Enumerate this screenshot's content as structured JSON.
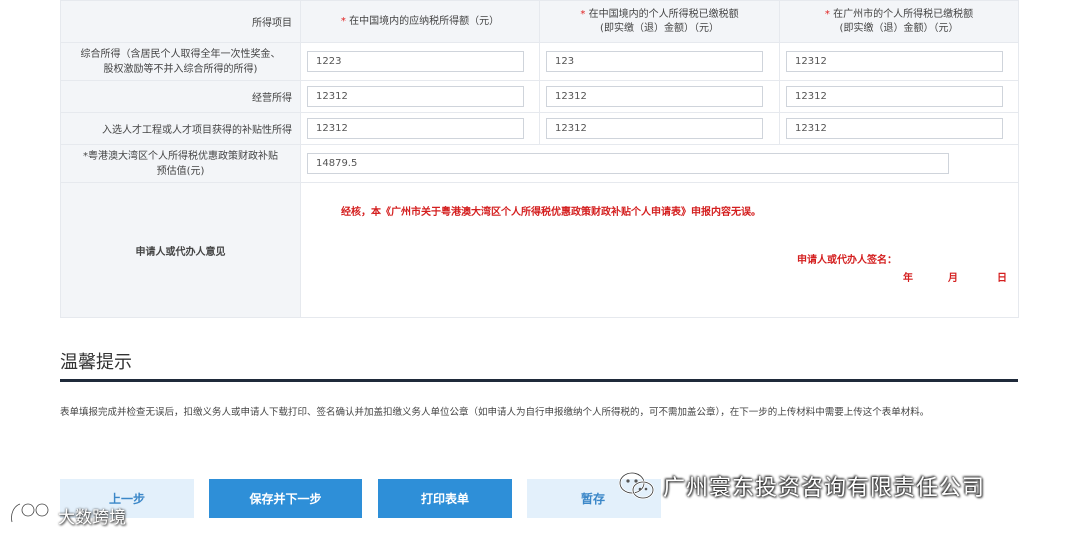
{
  "table": {
    "header": {
      "item_label": "所得项目",
      "col1_req": "*",
      "col1": "在中国境内的应纳税所得额（元）",
      "col2_req": "*",
      "col2_line1": "在中国境内的个人所得税已缴税额",
      "col2_line2": "(即实缴（退）金额）（元）",
      "col3_req": "*",
      "col3_line1": "在广州市的个人所得税已缴税额",
      "col3_line2": "(即实缴（退）金额）（元）"
    },
    "rows": [
      {
        "label_line1": "综合所得（含居民个人取得全年一次性奖金、",
        "label_line2": "股权激励等不并入综合所得的所得)",
        "values": [
          "1223",
          "123",
          "12312"
        ]
      },
      {
        "label": "经营所得",
        "values": [
          "12312",
          "12312",
          "12312"
        ]
      },
      {
        "label": "入选人才工程或人才项目获得的补贴性所得",
        "values": [
          "12312",
          "12312",
          "12312"
        ]
      }
    ],
    "estimate": {
      "label_line1": "*粤港澳大湾区个人所得税优惠政策财政补贴",
      "label_line2": "预估值(元)",
      "value": "14879.5"
    },
    "opinion": {
      "label": "申请人或代办人意见",
      "statement": "经核，本《广州市关于粤港澳大湾区个人所得税优惠政策财政补贴个人申请表》申报内容无误。",
      "sign_label": "申请人或代办人签名：",
      "year": "年",
      "month": "月",
      "day": "日"
    }
  },
  "tips": {
    "title": "温馨提示",
    "text": "表单填报完成并检查无误后，扣缴义务人或申请人下载打印、签名确认并加盖扣缴义务人单位公章（如申请人为自行申报缴纳个人所得税的，可不需加盖公章），在下一步的上传材料中需要上传这个表单材料。"
  },
  "buttons": {
    "prev": "上一步",
    "save_next": "保存并下一步",
    "print": "打印表单",
    "temp_save": "暂存"
  },
  "watermarks": {
    "company": "广州寰东投资咨询有限责任公司",
    "left": "大数跨境",
    "company_icon": "wechat-icon",
    "left_icon": "logo-icon"
  },
  "colors": {
    "primary_button": "#2e8fd8",
    "secondary_button": "#e3f0fb",
    "required_red": "#d41f1f",
    "label_bg": "#f3f5f8"
  }
}
